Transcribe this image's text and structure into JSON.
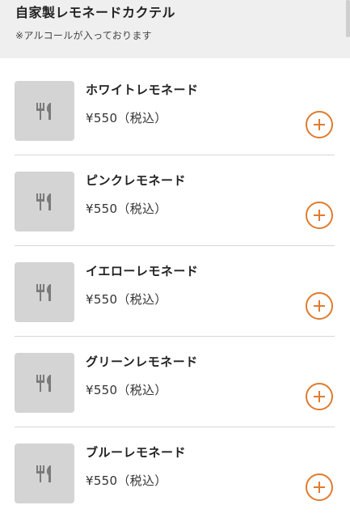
{
  "header": {
    "title": "自家製レモネードカクテル",
    "note": "※アルコールが入っております"
  },
  "colors": {
    "accent": "#e07b2e",
    "thumb_bg": "#d4d4d4",
    "header_bg": "#efefef"
  },
  "icons": {
    "thumb": "fork-knife-icon",
    "add": "plus-icon"
  },
  "items": [
    {
      "name": "ホワイトレモネード",
      "price": "¥550（税込）"
    },
    {
      "name": "ピンクレモネード",
      "price": "¥550（税込）"
    },
    {
      "name": "イエローレモネード",
      "price": "¥550（税込）"
    },
    {
      "name": "グリーンレモネード",
      "price": "¥550（税込）"
    },
    {
      "name": "ブルーレモネード",
      "price": "¥550（税込）"
    }
  ]
}
